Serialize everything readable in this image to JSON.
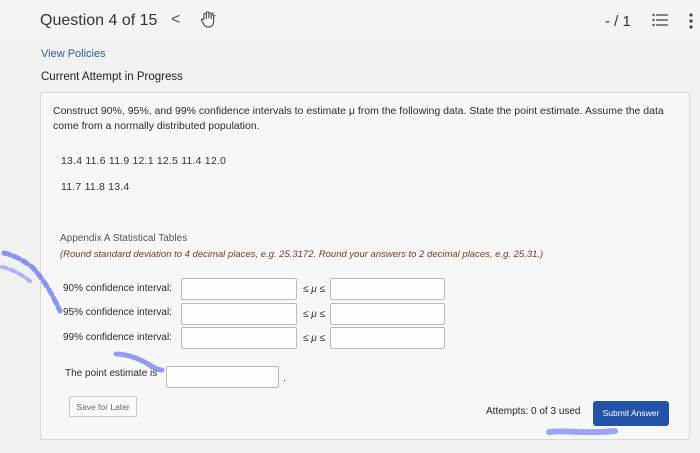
{
  "header": {
    "question_counter": "Question 4 of 15",
    "prev_glyph": "<",
    "score": "- / 1"
  },
  "links": {
    "view_policies": "View Policies"
  },
  "attempt_heading": "Current Attempt in Progress",
  "problem": {
    "prompt_line1": "Construct 90%, 95%, and 99% confidence intervals to estimate μ from the following data. State the point estimate. Assume the data",
    "prompt_line2": "come from a normally distributed population.",
    "data_row1": "13.4   11.6   11.9   12.1   12.5   11.4   12.0",
    "data_row2": "11.7   11.8   13.4",
    "appendix_link": "Appendix A Statistical Tables",
    "instructions": "(Round standard deviation to 4 decimal places, e.g. 25.3172. Round your answers to 2 decimal places, e.g. 25.31.)"
  },
  "intervals": [
    {
      "label": "90% confidence interval:",
      "mu": "≤ μ ≤"
    },
    {
      "label": "95% confidence interval:",
      "mu": "≤ μ ≤"
    },
    {
      "label": "99% confidence interval:",
      "mu": "≤ μ ≤"
    }
  ],
  "point_estimate": {
    "label": "The point estimate is",
    "suffix": "."
  },
  "footer": {
    "save_label": "Save for Later",
    "attempts": "Attempts: 0 of 3 used",
    "submit_label": "Submit Answer"
  },
  "colors": {
    "accent": "#2253a7",
    "link": "#2f5a8f",
    "instructions": "#7a3b1e"
  }
}
